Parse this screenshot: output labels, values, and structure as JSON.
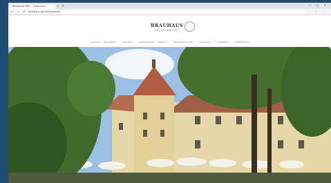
{
  "browser": {
    "tab_title": "Brauhaus 1851 · Kulinarisch",
    "tab_close": "×",
    "new_tab": "+",
    "window_controls": "— □ ×",
    "nav_buttons": "← → ⟳",
    "url": "brauhaus-wb.de/startseite",
    "toolbar_icons": "☆ ⋮"
  },
  "site": {
    "logo_title": "BRAUHAUS",
    "logo_subtitle": "WEIßENBURG",
    "nav": [
      "SCHLOSS · BRAUEREI",
      "GASTRO",
      "SPEISEKARTE · EVENTS",
      "ÜBERNACHTUNG",
      "ANGEBOT",
      "KONTAKT",
      "IMPRESSUM"
    ]
  },
  "hero": {
    "image": "castle-courtyard-beer-garden"
  }
}
